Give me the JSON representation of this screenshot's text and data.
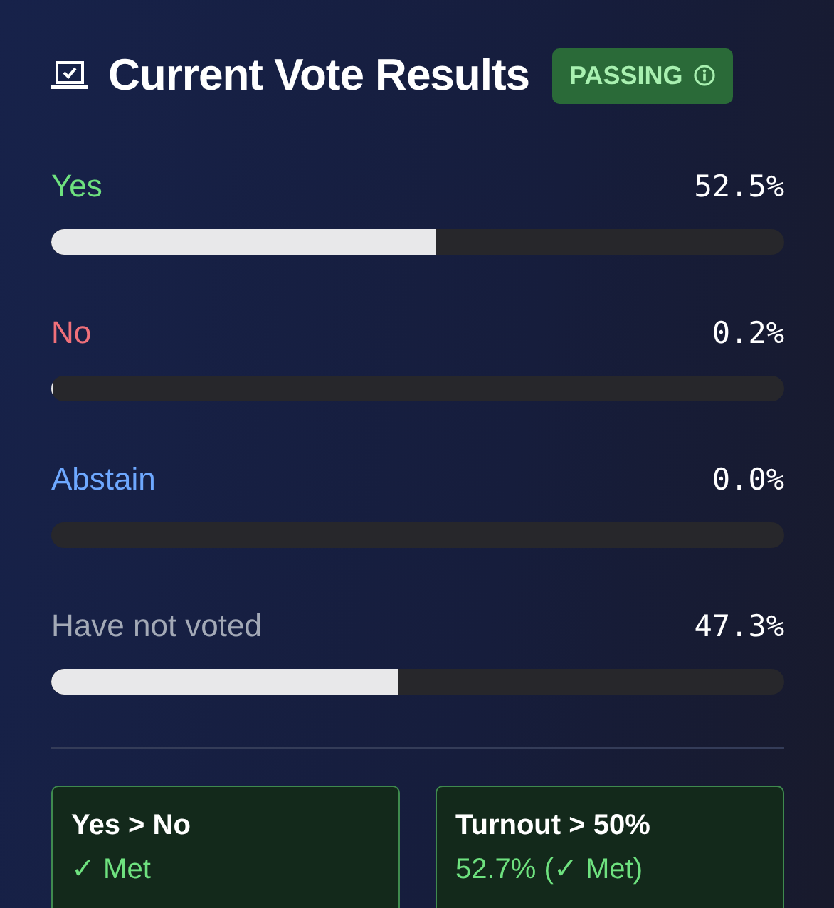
{
  "header": {
    "title": "Current Vote Results",
    "status": "PASSING",
    "passing": true
  },
  "options": [
    {
      "label": "Yes",
      "color": "#6ee17f",
      "reading": "52.5%",
      "level": 0.525
    },
    {
      "label": "No",
      "color": "#f0707a",
      "reading": "0.2%",
      "level": 0.002
    },
    {
      "label": "Abstain",
      "color": "#6ea8ff",
      "reading": "0.0%"
    },
    {
      "label": "Have not voted",
      "color": "#a3a9b6",
      "reading": "47.3%",
      "level": 0.473
    }
  ],
  "criteria": [
    {
      "title": "Yes > No",
      "result": "✓ Met",
      "met": true
    },
    {
      "title": "Turnout > 50%",
      "result": "52.7% (✓ Met)",
      "met": true
    }
  ]
}
